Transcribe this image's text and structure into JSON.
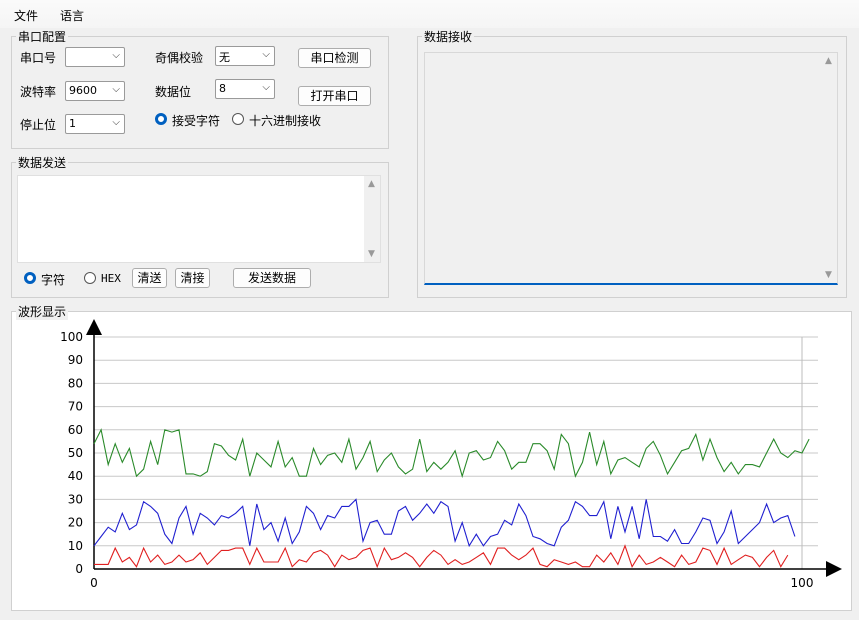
{
  "menu": {
    "file": "文件",
    "language": "语言"
  },
  "serial_config": {
    "title": "串口配置",
    "port_label": "串口号",
    "port_value": "",
    "baud_label": "波特率",
    "baud_value": "9600",
    "stop_label": "停止位",
    "stop_value": "1",
    "parity_label": "奇偶校验",
    "parity_value": "无",
    "databits_label": "数据位",
    "databits_value": "8",
    "detect_button": "串口检测",
    "open_button": "打开串口",
    "recv_char_label": "接受字符",
    "recv_hex_label": "十六进制接收",
    "recv_mode": "char"
  },
  "send": {
    "title": "数据发送",
    "char_label": "字符",
    "hex_label": "HEX",
    "clear_send": "清送",
    "clear_recv": "清接",
    "send_button": "发送数据",
    "mode": "char"
  },
  "receive": {
    "title": "数据接收"
  },
  "waveform": {
    "title": "波形显示"
  },
  "chart_data": {
    "type": "line",
    "xlim": [
      0,
      100
    ],
    "ylim": [
      0,
      100
    ],
    "y_ticks": [
      0,
      10,
      20,
      30,
      40,
      50,
      60,
      70,
      80,
      90,
      100
    ],
    "x_ticks": [
      0,
      100
    ],
    "grid": true,
    "series": [
      {
        "color": "#2a8a2a",
        "values": [
          54,
          60,
          45,
          54,
          46,
          52,
          40,
          43,
          55,
          45,
          60,
          59,
          60,
          41,
          41,
          40,
          42,
          54,
          53,
          49,
          47,
          56,
          40,
          50,
          47,
          44,
          55,
          44,
          48,
          40,
          40,
          52,
          45,
          49,
          50,
          46,
          56,
          43,
          48,
          55,
          42,
          47,
          50,
          44,
          41,
          43,
          56,
          42,
          46,
          43,
          46,
          51,
          40,
          50,
          51,
          47,
          48,
          55,
          51,
          43,
          46,
          46,
          54,
          54,
          51,
          43,
          58,
          54,
          40,
          46,
          59,
          45,
          55,
          41,
          47,
          48,
          46,
          44,
          52,
          55,
          49,
          41,
          46,
          51,
          52,
          58,
          47,
          56,
          48,
          42,
          46,
          41,
          45,
          45,
          44,
          50,
          56,
          50,
          48,
          51,
          50,
          56
        ]
      },
      {
        "color": "#2020d0",
        "values": [
          10,
          14,
          18,
          16,
          24,
          17,
          19,
          29,
          27,
          24,
          15,
          11,
          22,
          27,
          15,
          24,
          22,
          19,
          23,
          22,
          24,
          27,
          10,
          28,
          17,
          20,
          12,
          22,
          11,
          16,
          27,
          24,
          17,
          23,
          22,
          27,
          27,
          30,
          12,
          20,
          21,
          15,
          15,
          25,
          27,
          21,
          24,
          28,
          24,
          29,
          27,
          12,
          20,
          10,
          15,
          10,
          14,
          15,
          21,
          19,
          28,
          23,
          14,
          13,
          11,
          10,
          18,
          21,
          29,
          27,
          23,
          23,
          29,
          13,
          27,
          16,
          27,
          13,
          30,
          14,
          14,
          12,
          17,
          11,
          11,
          16,
          22,
          21,
          11,
          16,
          25,
          11,
          14,
          17,
          20,
          28,
          20,
          22,
          23,
          14
        ]
      },
      {
        "color": "#e02020",
        "values": [
          2,
          2,
          2,
          9,
          3,
          5,
          1,
          9,
          3,
          6,
          2,
          3,
          6,
          3,
          4,
          7,
          2,
          5,
          8,
          8,
          9,
          9,
          2,
          9,
          3,
          3,
          3,
          9,
          1,
          4,
          3,
          7,
          8,
          6,
          1,
          6,
          4,
          5,
          8,
          9,
          1,
          9,
          4,
          5,
          7,
          5,
          1,
          5,
          8,
          6,
          2,
          4,
          2,
          3,
          5,
          7,
          2,
          9,
          9,
          6,
          4,
          6,
          9,
          2,
          1,
          4,
          3,
          2,
          3,
          1,
          1,
          6,
          3,
          7,
          2,
          10,
          1,
          6,
          2,
          3,
          5,
          3,
          1,
          6,
          2,
          3,
          9,
          8,
          2,
          9,
          2,
          4,
          6,
          5,
          1,
          5,
          8,
          1,
          6
        ]
      }
    ]
  }
}
